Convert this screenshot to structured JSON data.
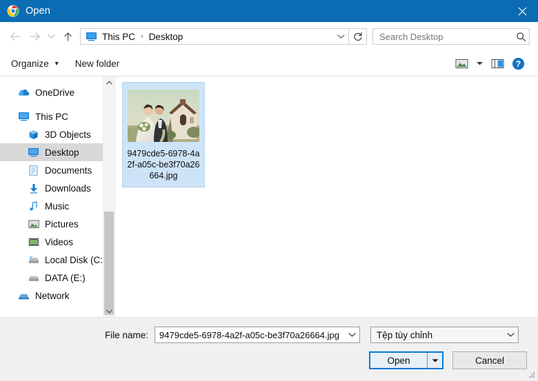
{
  "window": {
    "title": "Open",
    "app_icon": "chrome-icon",
    "close_icon": "close-icon",
    "titlebar_color": "#0b6cb3"
  },
  "navigation": {
    "back_icon": "back-arrow-icon",
    "forward_icon": "forward-arrow-icon",
    "recent_icon": "chevron-down-icon",
    "up_icon": "up-arrow-icon",
    "breadcrumb": {
      "root_icon": "this-pc-icon",
      "items": [
        "This PC",
        "Desktop"
      ],
      "separator": "›",
      "dropdown_icon": "chevron-down-icon"
    },
    "refresh_icon": "refresh-icon",
    "search": {
      "placeholder": "Search Desktop",
      "value": "",
      "icon": "search-icon"
    }
  },
  "toolbar": {
    "organize_label": "Organize",
    "organize_caret": "▼",
    "new_folder_label": "New folder",
    "view_icon": "view-mode-icon",
    "view_caret": "▼",
    "preview_pane_icon": "preview-pane-icon",
    "help_icon": "help-icon"
  },
  "sidebar": {
    "items": [
      {
        "label": "OneDrive",
        "icon": "onedrive-icon",
        "level": 0,
        "selected": false
      },
      {
        "label": "This PC",
        "icon": "this-pc-icon",
        "level": 0,
        "selected": false
      },
      {
        "label": "3D Objects",
        "icon": "3d-objects-icon",
        "level": 1,
        "selected": false
      },
      {
        "label": "Desktop",
        "icon": "desktop-icon",
        "level": 1,
        "selected": true
      },
      {
        "label": "Documents",
        "icon": "documents-icon",
        "level": 1,
        "selected": false
      },
      {
        "label": "Downloads",
        "icon": "downloads-icon",
        "level": 1,
        "selected": false
      },
      {
        "label": "Music",
        "icon": "music-icon",
        "level": 1,
        "selected": false
      },
      {
        "label": "Pictures",
        "icon": "pictures-icon",
        "level": 1,
        "selected": false
      },
      {
        "label": "Videos",
        "icon": "videos-icon",
        "level": 1,
        "selected": false
      },
      {
        "label": "Local Disk (C:)",
        "icon": "drive-icon",
        "level": 1,
        "selected": false
      },
      {
        "label": "DATA (E:)",
        "icon": "drive-icon",
        "level": 1,
        "selected": false
      },
      {
        "label": "Network",
        "icon": "network-icon",
        "level": 0,
        "selected": false
      }
    ],
    "scrollbar": {
      "up_icon": "scroll-up-icon",
      "down_icon": "scroll-down-icon"
    }
  },
  "files": [
    {
      "name": "9479cde5-6978-4a2f-a05c-be3f70a26664.jpg",
      "selected": true,
      "thumbnail": "wedding-photo-thumbnail"
    }
  ],
  "footer": {
    "file_name_label": "File name:",
    "file_name_value": "9479cde5-6978-4a2f-a05c-be3f70a26664.jpg",
    "file_name_dropdown_icon": "chevron-down-icon",
    "file_type_value": "Tệp tùy chỉnh",
    "file_type_dropdown_icon": "chevron-down-icon",
    "open_label": "Open",
    "open_split_icon": "caret-down-icon",
    "cancel_label": "Cancel",
    "resize_grip_icon": "resize-grip-icon"
  }
}
